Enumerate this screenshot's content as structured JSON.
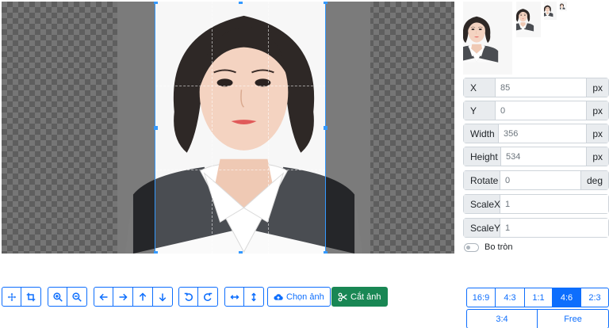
{
  "crop_panel": {
    "fields": [
      {
        "label": "X",
        "value": "85",
        "unit": "px"
      },
      {
        "label": "Y",
        "value": "0",
        "unit": "px"
      },
      {
        "label": "Width",
        "value": "356",
        "unit": "px"
      },
      {
        "label": "Height",
        "value": "534",
        "unit": "px"
      },
      {
        "label": "Rotate",
        "value": "0",
        "unit": "deg"
      },
      {
        "label": "ScaleX",
        "value": "1",
        "unit": ""
      },
      {
        "label": "ScaleY",
        "value": "1",
        "unit": ""
      }
    ],
    "toggle_label": "Bo tròn"
  },
  "toolbar": {
    "choose_image_label": "Chọn ảnh",
    "crop_image_label": "Cắt ảnh"
  },
  "aspect_ratios": {
    "row1": [
      "16:9",
      "4:3",
      "1:1",
      "4:6",
      "2:3"
    ],
    "row2": [
      "3:4",
      "Free"
    ],
    "active": "4:6"
  },
  "colors": {
    "primary": "#0d6efd",
    "success": "#198754",
    "crop_outline": "#3399ff"
  }
}
